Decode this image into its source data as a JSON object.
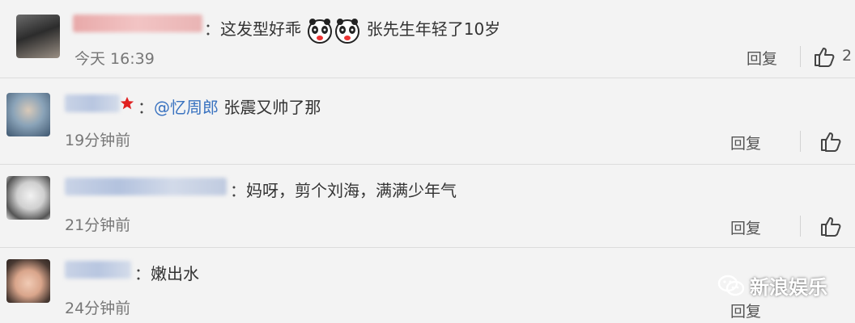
{
  "comments": [
    {
      "text_before": "这发型好乖",
      "text_after": "张先生年轻了10岁",
      "time": "今天 16:39",
      "reply": "回复",
      "likes": "2",
      "emoji_icon": "panda-face-icon"
    },
    {
      "mention": "@忆周郎",
      "text": "张震又帅了那",
      "time": "19分钟前",
      "reply": "回复"
    },
    {
      "text": "妈呀，剪个刘海，满满少年气",
      "time": "21分钟前",
      "reply": "回复"
    },
    {
      "text": "嫩出水",
      "time": "24分钟前",
      "reply": "回复"
    }
  ],
  "colon": "：",
  "watermark": "新浪娱乐",
  "colors": {
    "background": "#f3f3f3",
    "mention": "#3a73c0",
    "divider": "#dcdcdc"
  }
}
